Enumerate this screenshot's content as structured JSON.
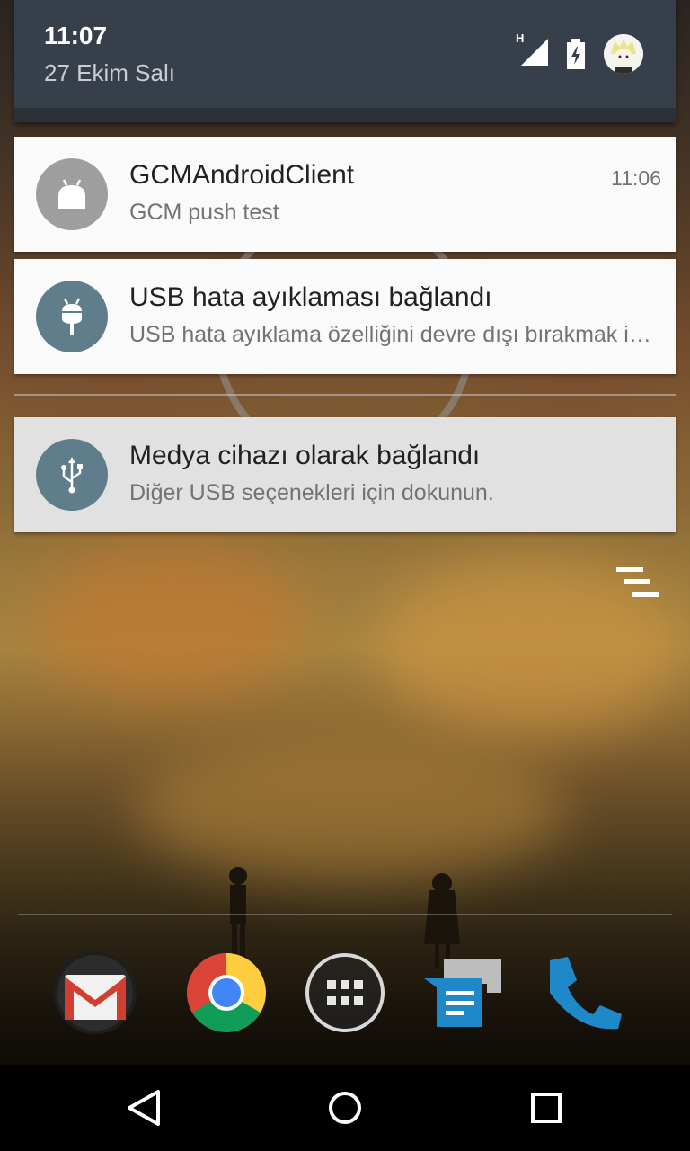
{
  "status_bar": {
    "time": "11:07",
    "date": "27 Ekim Salı",
    "network_type": "H",
    "icons": [
      "signal-icon",
      "battery-charging-icon",
      "user-avatar"
    ]
  },
  "notifications": [
    {
      "app_icon": "android-icon",
      "icon_bg": "#9e9e9e",
      "title": "GCMAndroidClient",
      "text": "GCM push test",
      "time": "11:06"
    },
    {
      "app_icon": "android-debug-icon",
      "icon_bg": "#607d8b",
      "title": "USB hata ayıklaması bağlandı",
      "text": "USB hata ayıklama özelliğini devre dışı bırakmak için dokunun."
    },
    {
      "app_icon": "usb-icon",
      "icon_bg": "#607d8b",
      "title": "Medya cihazı olarak bağlandı",
      "text": "Diğer USB seçenekleri için dokunun."
    }
  ],
  "dock": [
    "gmail-icon",
    "chrome-icon",
    "app-drawer-icon",
    "messenger-icon",
    "phone-icon"
  ],
  "navbar": [
    "back-icon",
    "home-icon",
    "recents-icon"
  ]
}
